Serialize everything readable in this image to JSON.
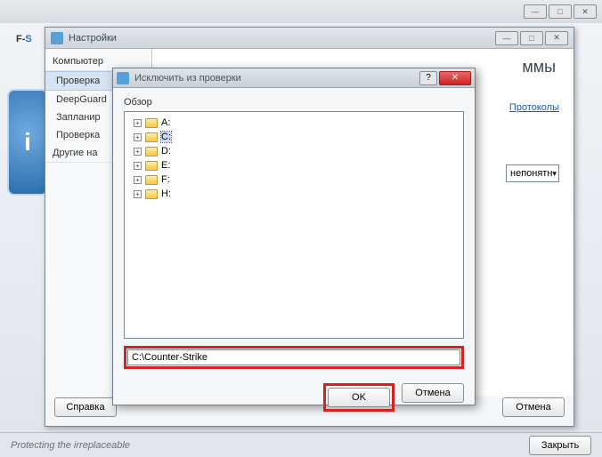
{
  "app": {
    "logo_prefix": "F-",
    "logo_suffix": "S",
    "status_text": "Protecting the irreplaceable",
    "close_footer_label": "Закрыть"
  },
  "settings_window": {
    "title": "Настройки",
    "sidebar": {
      "group_label": "Компьютер",
      "items": [
        {
          "label": "Проверка"
        },
        {
          "label": "DeepGuard"
        },
        {
          "label": "Запланир"
        },
        {
          "label": "Проверка"
        }
      ],
      "other_label": "Другие на"
    },
    "main_area": {
      "programs_label": "ммы",
      "protocols_link": "Протоколы",
      "dropdown_value": "непонятн"
    },
    "footer": {
      "help_label": "Справка",
      "cancel_label": "Отмена"
    }
  },
  "exclude_dialog": {
    "title": "Исключить из проверки",
    "group_label": "Обзор",
    "drives": [
      {
        "label": "A:"
      },
      {
        "label": "C:",
        "selected": true
      },
      {
        "label": "D:"
      },
      {
        "label": "E:"
      },
      {
        "label": "F:"
      },
      {
        "label": "H:"
      }
    ],
    "path_value": "C:\\Counter-Strike",
    "ok_label": "OK",
    "cancel_label": "Отмена"
  }
}
